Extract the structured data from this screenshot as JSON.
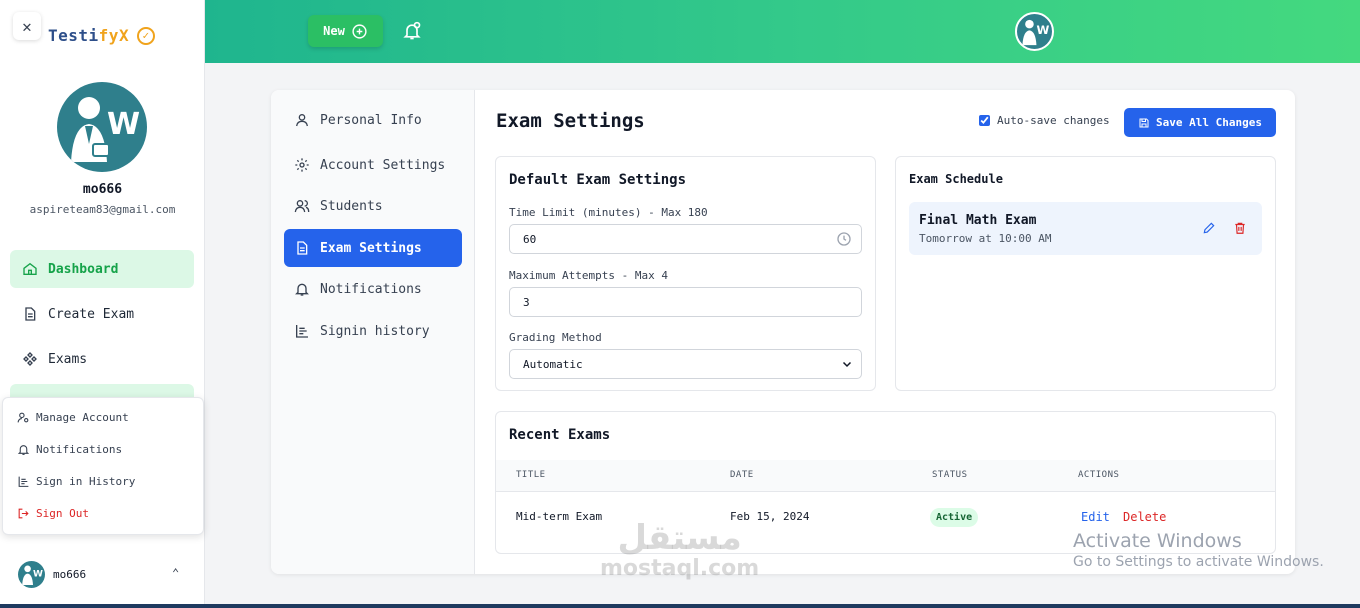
{
  "brand": {
    "part1": "Testi",
    "part2": "fyX",
    "badge_icon": "check-circle-icon"
  },
  "profile": {
    "name": "mo666",
    "email": "aspireteam83@gmail.com"
  },
  "sidebar": {
    "items": [
      {
        "label": "Dashboard",
        "icon": "home-icon",
        "active": true
      },
      {
        "label": "Create Exam",
        "icon": "document-icon",
        "active": false
      },
      {
        "label": "Exams",
        "icon": "grid-diamond-icon",
        "active": false
      }
    ]
  },
  "account_menu": {
    "items": [
      {
        "label": "Manage Account",
        "icon": "user-gear-icon"
      },
      {
        "label": "Notifications",
        "icon": "bell-icon"
      },
      {
        "label": "Sign in History",
        "icon": "chart-list-icon"
      },
      {
        "label": "Sign Out",
        "icon": "sign-out-icon"
      }
    ]
  },
  "footer_user": {
    "name": "mo666"
  },
  "topbar": {
    "new_label": "New"
  },
  "settings_nav": {
    "items": [
      {
        "label": "Personal Info",
        "icon": "user-icon"
      },
      {
        "label": "Account Settings",
        "icon": "gear-icon"
      },
      {
        "label": "Students",
        "icon": "users-icon"
      },
      {
        "label": "Exam Settings",
        "icon": "document-icon",
        "active": true
      },
      {
        "label": "Notifications",
        "icon": "bell-icon"
      },
      {
        "label": "Signin history",
        "icon": "chart-list-icon"
      }
    ]
  },
  "header": {
    "title": "Exam Settings",
    "autosave_label": "Auto-save changes",
    "autosave_checked": true,
    "save_label": "Save All Changes"
  },
  "defaults": {
    "title": "Default Exam Settings",
    "time_limit_label": "Time Limit (minutes) - Max 180",
    "time_limit_value": "60",
    "attempts_label": "Maximum Attempts - Max 4",
    "attempts_value": "3",
    "grading_label": "Grading Method",
    "grading_value": "Automatic"
  },
  "schedule": {
    "title": "Exam Schedule",
    "items": [
      {
        "name": "Final Math Exam",
        "time": "Tomorrow at 10:00 AM"
      }
    ]
  },
  "recent": {
    "title": "Recent Exams",
    "columns": [
      "TITLE",
      "DATE",
      "STATUS",
      "ACTIONS"
    ],
    "rows": [
      {
        "title": "Mid-term Exam",
        "date": "Feb 15, 2024",
        "status": "Active",
        "edit": "Edit",
        "delete": "Delete"
      }
    ]
  },
  "watermark": {
    "line1": "Activate Windows",
    "line2": "Go to Settings to activate Windows.",
    "site_ar": "مستقل",
    "site_en": "mostaql.com"
  },
  "colors": {
    "accent": "#2563eb",
    "green": "#16a34a",
    "danger": "#dc2626",
    "brand_blue": "#2e4f8a",
    "brand_orange": "#f0a31c"
  }
}
